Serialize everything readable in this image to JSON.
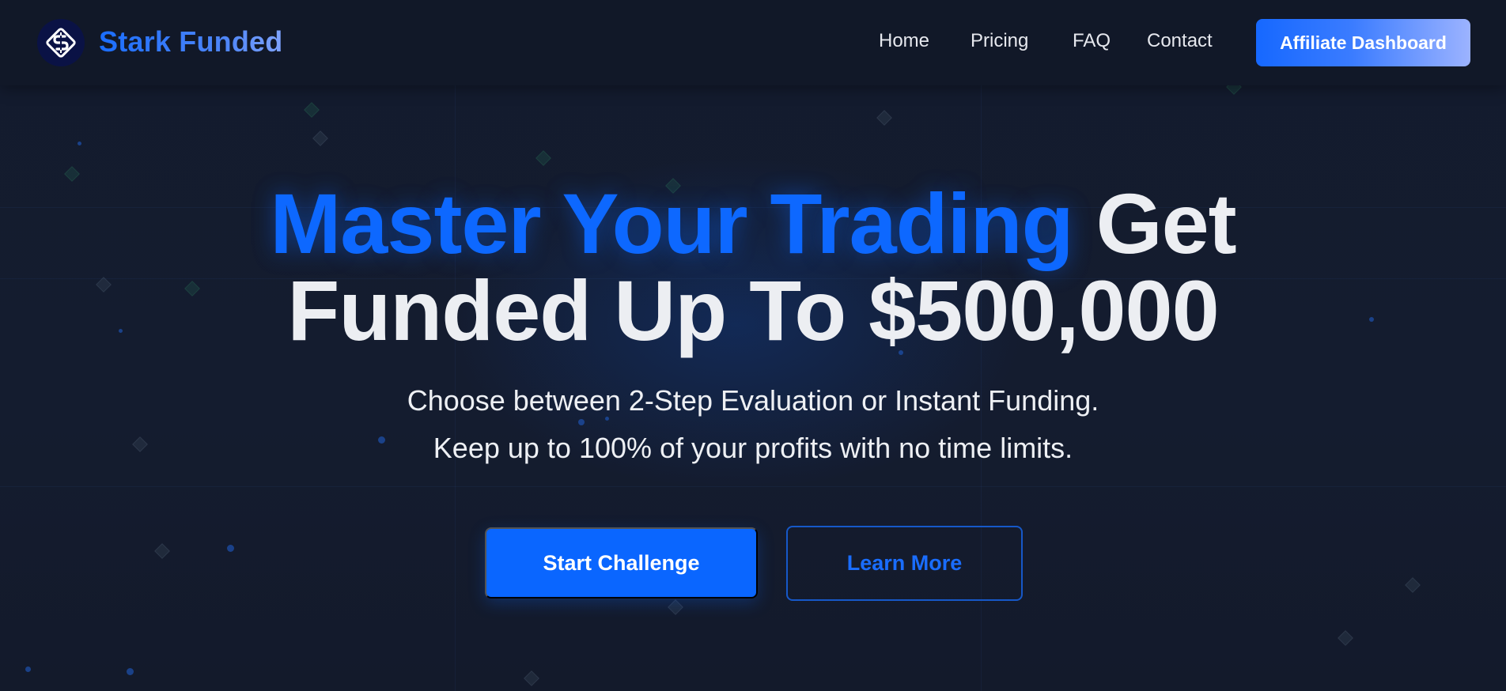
{
  "header": {
    "brand": "Stark Funded",
    "nav": [
      {
        "label": "Home"
      },
      {
        "label": "Pricing"
      },
      {
        "label": "FAQ"
      },
      {
        "label": "Contact"
      }
    ],
    "cta_label": "Affiliate Dashboard",
    "logo_icon": "dollar-s-logo-icon"
  },
  "hero": {
    "title_accent": "Master Your Trading",
    "title_rest_line1": "Get",
    "title_line2": "Funded Up To $500,000",
    "subtitle_line1": "Choose between 2-Step Evaluation or Instant Funding.",
    "subtitle_line2": "Keep up to 100% of your profits with no time limits.",
    "primary_button": "Start Challenge",
    "secondary_button": "Learn More"
  },
  "colors": {
    "background": "#121a2c",
    "header": "#111828",
    "accent": "#0a66ff",
    "text": "#eceef2"
  }
}
